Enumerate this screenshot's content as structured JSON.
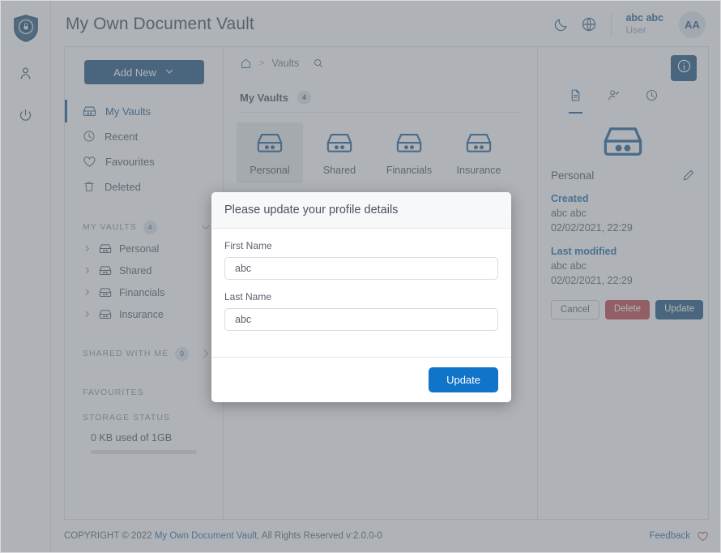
{
  "header": {
    "title": "My Own Document Vault",
    "dark_mode_icon": "moon-icon",
    "language_icon": "globe-icon",
    "user_name": "abc abc",
    "user_role": "User",
    "avatar_initials": "AA"
  },
  "rail": {
    "logo_icon": "shield-lock-logo",
    "profile_icon": "person-icon",
    "power_icon": "power-icon"
  },
  "leftnav": {
    "add_new_label": "Add New",
    "nav_items": [
      {
        "label": "My Vaults",
        "icon": "vault-icon",
        "active": true
      },
      {
        "label": "Recent",
        "icon": "clock-icon",
        "active": false
      },
      {
        "label": "Favourites",
        "icon": "heart-icon",
        "active": false
      },
      {
        "label": "Deleted",
        "icon": "trash-icon",
        "active": false
      }
    ],
    "my_vaults_section": {
      "title": "MY VAULTS",
      "count": "4"
    },
    "tree_items": [
      {
        "label": "Personal"
      },
      {
        "label": "Shared"
      },
      {
        "label": "Financials"
      },
      {
        "label": "Insurance"
      }
    ],
    "shared_section": {
      "title": "SHARED WITH ME",
      "count": "0"
    },
    "favourites_section": {
      "title": "FAVOURITES"
    },
    "storage": {
      "title": "STORAGE STATUS",
      "text": "0 KB used of 1GB",
      "percent": 0
    }
  },
  "center": {
    "breadcrumb": {
      "home_icon": "home-icon",
      "separator": ">",
      "current": "Vaults",
      "search_icon": "search-icon"
    },
    "vaults_header": {
      "title": "My Vaults",
      "count": "4"
    },
    "vaults": [
      {
        "label": "Personal",
        "selected": true
      },
      {
        "label": "Shared",
        "selected": false
      },
      {
        "label": "Financials",
        "selected": false
      },
      {
        "label": "Insurance",
        "selected": false
      }
    ]
  },
  "right": {
    "info_icon": "info-circle-icon",
    "tabs": [
      {
        "icon": "document-icon",
        "active": true
      },
      {
        "icon": "person-check-icon",
        "active": false
      },
      {
        "icon": "history-clock-icon",
        "active": false
      }
    ],
    "vault_icon": "vault-icon",
    "vault_name": "Personal",
    "edit_icon": "pencil-icon",
    "created_label": "Created",
    "created_by": "abc abc",
    "created_at": "02/02/2021, 22:29",
    "modified_label": "Last modified",
    "modified_by": "abc abc",
    "modified_at": "02/02/2021, 22:29",
    "cancel_label": "Cancel",
    "delete_label": "Delete",
    "update_label": "Update"
  },
  "footer": {
    "copyright_prefix": "COPYRIGHT © 2022",
    "brand_link": "My Own Document Vault",
    "copyright_suffix": ", All Rights Reserved v:2.0.0-0",
    "feedback_label": "Feedback",
    "heart_icon": "heart-icon"
  },
  "modal": {
    "title": "Please update your profile details",
    "first_name_label": "First Name",
    "first_name_value": "abc",
    "first_name_placeholder": "First Name",
    "last_name_label": "Last Name",
    "last_name_value": "abc",
    "last_name_placeholder": "Last Name",
    "update_label": "Update"
  },
  "colors": {
    "brand_blue": "#1f5580",
    "accent_blue": "#1074c8",
    "danger_red": "#c0444c",
    "overlay": "rgba(110,116,124,0.55)"
  }
}
